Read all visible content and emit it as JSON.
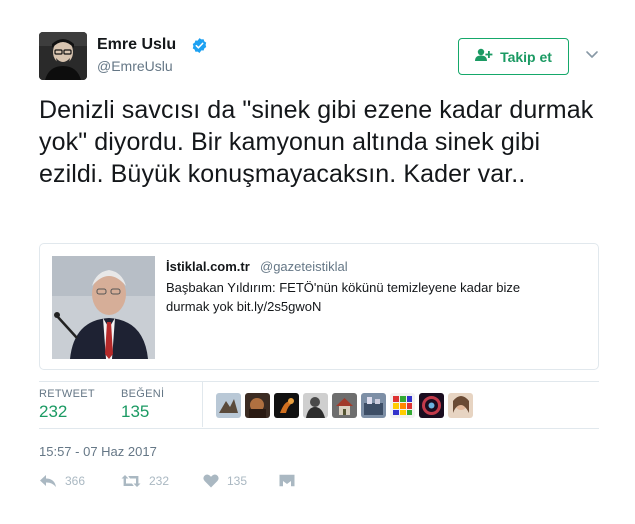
{
  "author": {
    "name": "Emre Uslu",
    "handle": "@EmreUslu",
    "verified": true
  },
  "follow_button": {
    "label": "Takip et",
    "icon": "add-user-icon"
  },
  "tweet": {
    "text": "Denizli savcısı da \"sinek gibi ezene kadar durmak yok\" diyordu. Bir kamyonun altında sinek gibi ezildi. Büyük konuşmayacaksın. Kader var.."
  },
  "quote_card": {
    "site": "İstiklal.com.tr",
    "handle": "@gazeteistiklal",
    "text": "Başbakan Yıldırım: FETÖ'nün kökünü temizleyene kadar bize durmak yok bit.ly/2s5gwoN"
  },
  "stats": {
    "retweet_label": "RETWEET",
    "retweet_count": "232",
    "like_label": "BEĞENİ",
    "like_count": "135"
  },
  "timestamp": "15:57 - 07 Haz 2017",
  "actions": {
    "reply_count": "366",
    "retweet_count": "232",
    "like_count": "135"
  },
  "colors": {
    "accent": "#1b9a63",
    "muted": "#657786",
    "verified": "#1da1f2",
    "border": "#e1e8ed"
  }
}
